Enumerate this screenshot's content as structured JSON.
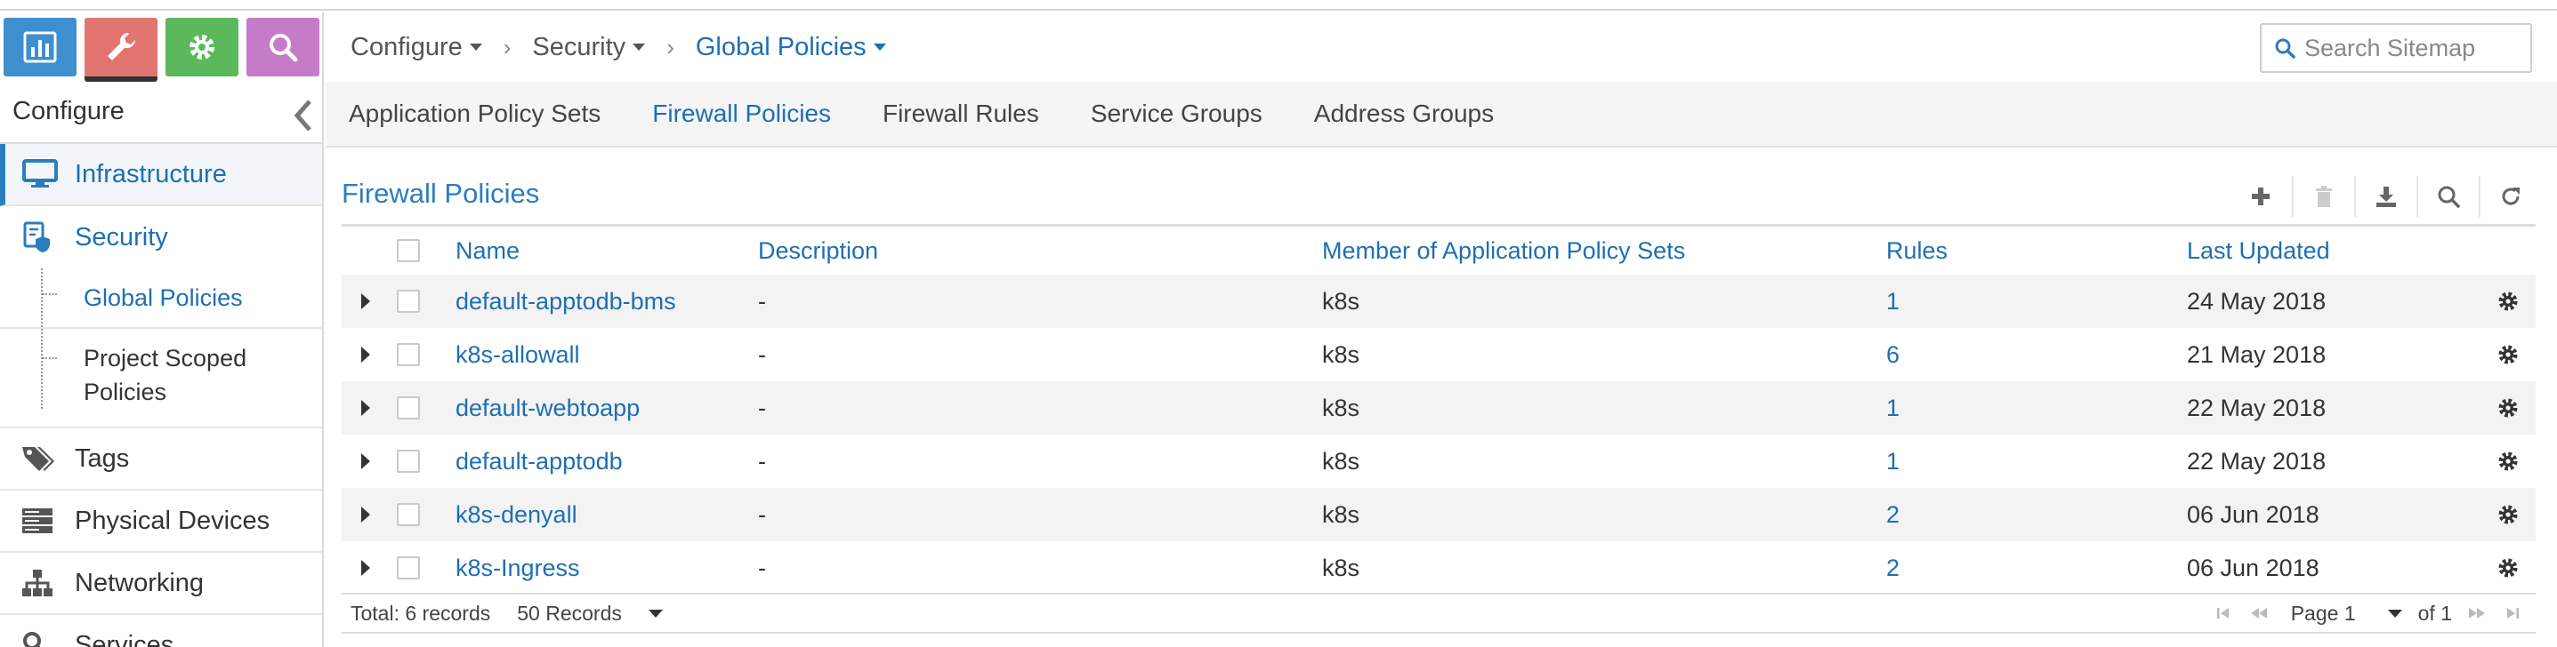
{
  "sidebar": {
    "title": "Configure",
    "items": [
      {
        "label": "Infrastructure"
      },
      {
        "label": "Security"
      },
      {
        "label": "Tags"
      },
      {
        "label": "Physical Devices"
      },
      {
        "label": "Networking"
      },
      {
        "label": "Services"
      }
    ],
    "security_children": [
      {
        "label": "Global Policies"
      },
      {
        "label": "Project Scoped Policies"
      }
    ]
  },
  "breadcrumb": {
    "items": [
      {
        "label": "Configure"
      },
      {
        "label": "Security"
      },
      {
        "label": "Global Policies"
      }
    ],
    "separator": "›"
  },
  "search": {
    "placeholder": "Search Sitemap"
  },
  "tabs": [
    {
      "label": "Application Policy Sets"
    },
    {
      "label": "Firewall Policies"
    },
    {
      "label": "Firewall Rules"
    },
    {
      "label": "Service Groups"
    },
    {
      "label": "Address Groups"
    }
  ],
  "panel": {
    "title": "Firewall Policies"
  },
  "table": {
    "headers": {
      "name": "Name",
      "description": "Description",
      "member": "Member of Application Policy Sets",
      "rules": "Rules",
      "updated": "Last Updated"
    },
    "rows": [
      {
        "name": "default-apptodb-bms",
        "description": "-",
        "member": "k8s",
        "rules": "1",
        "updated": "24 May 2018"
      },
      {
        "name": "k8s-allowall",
        "description": "-",
        "member": "k8s",
        "rules": "6",
        "updated": "21 May 2018"
      },
      {
        "name": "default-webtoapp",
        "description": "-",
        "member": "k8s",
        "rules": "1",
        "updated": "22 May 2018"
      },
      {
        "name": "default-apptodb",
        "description": "-",
        "member": "k8s",
        "rules": "1",
        "updated": "22 May 2018"
      },
      {
        "name": "k8s-denyall",
        "description": "-",
        "member": "k8s",
        "rules": "2",
        "updated": "06 Jun 2018"
      },
      {
        "name": "k8s-Ingress",
        "description": "-",
        "member": "k8s",
        "rules": "2",
        "updated": "06 Jun 2018"
      }
    ]
  },
  "footer": {
    "total": "Total: 6 records",
    "page_size": "50 Records",
    "page": "Page 1",
    "of": "of 1"
  },
  "colors": {
    "accent": "#1e6fb2",
    "monitor": "#3d8fd0",
    "configure": "#e27570",
    "settings": "#5cb85c",
    "query": "#c67bc8"
  }
}
